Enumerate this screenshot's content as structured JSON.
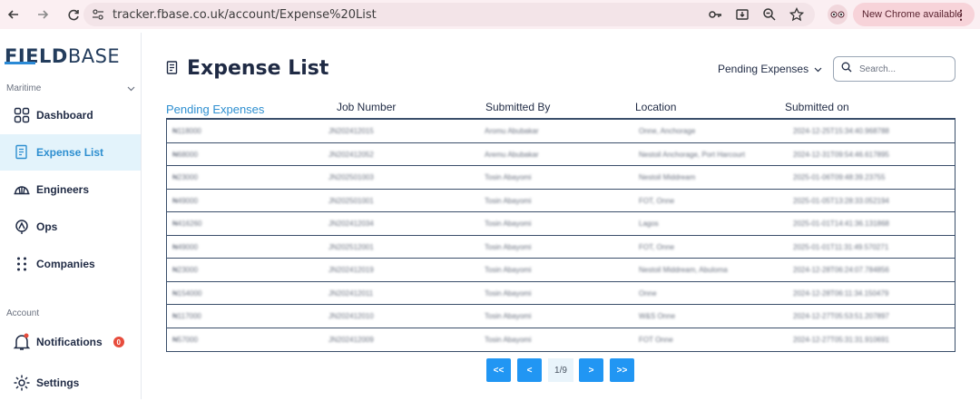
{
  "browser": {
    "url": "tracker.fbase.co.uk/account/Expense%20List",
    "update_label": "New Chrome available"
  },
  "sidebar": {
    "logo_bold": "FIELD",
    "logo_light": "BASE",
    "section_maritime": "Maritime",
    "section_account": "Account",
    "items": [
      {
        "label": "Dashboard",
        "icon": "grid-icon"
      },
      {
        "label": "Expense List",
        "icon": "document-icon"
      },
      {
        "label": "Engineers",
        "icon": "hardhat-icon"
      },
      {
        "label": "Ops",
        "icon": "ops-icon"
      },
      {
        "label": "Companies",
        "icon": "dots-icon"
      },
      {
        "label": "Notifications",
        "icon": "bell-icon",
        "badge": "0"
      },
      {
        "label": "Settings",
        "icon": "gear-icon"
      }
    ]
  },
  "main": {
    "title": "Expense List",
    "filter_label": "Pending Expenses",
    "search_placeholder": "Search..."
  },
  "table": {
    "headers": [
      "Pending Expenses",
      "Job Number",
      "Submitted By",
      "Location",
      "Submitted on"
    ],
    "rows": [
      [
        "₦118000",
        "JN202412015",
        "Aromu Abubakar",
        "Onne, Anchorage",
        "2024-12-25T15:34:40.968788"
      ],
      [
        "₦68000",
        "JN202412052",
        "Aremu Abubakar",
        "Nestoil Anchorage, Port Harcourt",
        "2024-12-31T09:54:46.617895"
      ],
      [
        "₦23000",
        "JN202501003",
        "Tosin Abayomi",
        "Nestoil Middream",
        "2025-01-06T09:48:39.23755"
      ],
      [
        "₦49000",
        "JN202501001",
        "Tosin Abayomi",
        "FOT, Onne",
        "2025-01-05T13:28:33.052194"
      ],
      [
        "₦416260",
        "JN202412034",
        "Tosin Abayomi",
        "Lagos",
        "2025-01-01T14:41:36.131868"
      ],
      [
        "₦49000",
        "JN202512001",
        "Tosin Abayomi",
        "FOT, Onne",
        "2025-01-01T11:31:49.570271"
      ],
      [
        "₦23000",
        "JN202412019",
        "Tosin Abayomi",
        "Nestoil Middream, Abuloma",
        "2024-12-28T06:24:07.784856"
      ],
      [
        "₦154000",
        "JN202412011",
        "Tosin Abayomi",
        "Onne",
        "2024-12-28T06:11:34.150479"
      ],
      [
        "₦117000",
        "JN202412010",
        "Tosin Abayomi",
        "W&S Onne",
        "2024-12-27T05:53:51.207897"
      ],
      [
        "₦57000",
        "JN202412009",
        "Tosin Abayomi",
        "FOT Onne",
        "2024-12-27T05:31:31.910691"
      ]
    ]
  },
  "pagination": {
    "first": "<<",
    "prev": "<",
    "info": "1/9",
    "next": ">",
    "last": ">>"
  }
}
